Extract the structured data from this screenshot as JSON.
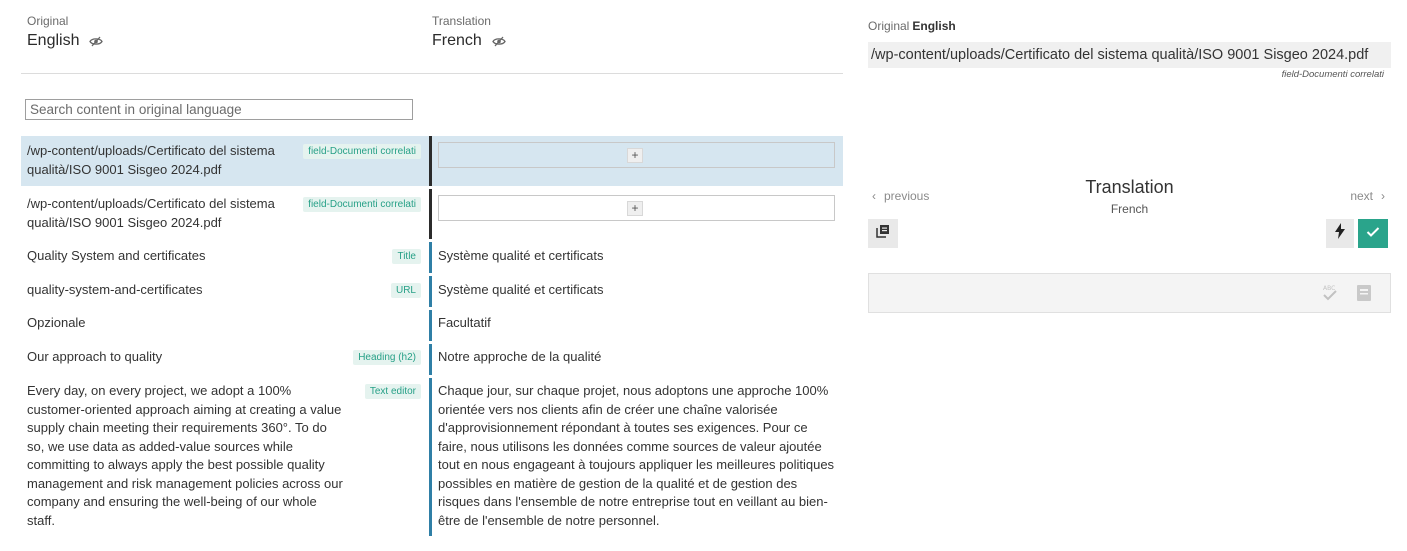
{
  "left": {
    "original": {
      "caption": "Original",
      "language": "English"
    },
    "translation": {
      "caption": "Translation",
      "language": "French"
    },
    "search_placeholder": "Search content in original language",
    "rows": [
      {
        "original": "/wp-content/uploads/Certificato del sistema qualità/ISO 9001 Sisgeo 2024.pdf",
        "tag": "field-Documenti correlati",
        "translation": ""
      },
      {
        "original": "/wp-content/uploads/Certificato del sistema qualità/ISO 9001 Sisgeo 2024.pdf",
        "tag": "field-Documenti correlati",
        "translation": ""
      },
      {
        "original": "Quality System and certificates",
        "tag": "Title",
        "translation": "Système qualité et certificats"
      },
      {
        "original": "quality-system-and-certificates",
        "tag": "URL",
        "translation": "Système qualité et certificats"
      },
      {
        "original": "Opzionale",
        "tag": "",
        "translation": "Facultatif"
      },
      {
        "original": "Our approach to quality",
        "tag": "Heading (h2)",
        "translation": "Notre approche de la qualité"
      },
      {
        "original": "Every day, on every project, we adopt a 100% customer-oriented approach aiming at creating a value supply chain meeting their requirements 360°. To do so, we use data as added-value sources while committing to always apply the best possible quality management and risk management policies across our company and ensuring the well-being of our whole staff.",
        "tag": "Text editor",
        "translation": "Chaque jour, sur chaque projet, nous adoptons une approche 100% orientée vers nos clients afin de créer une chaîne valorisée d'approvisionnement répondant à toutes ses exigences. Pour ce faire, nous utilisons les données comme sources de valeur ajoutée tout en nous engageant à toujours appliquer les meilleures politiques possibles en matière de gestion de la qualité et de gestion des risques dans l'ensemble de notre entreprise tout en veillant au bien-être de l'ensemble de notre personnel."
      }
    ],
    "plus_label": "+"
  },
  "right": {
    "original_caption": "Original",
    "original_language": "English",
    "source_text": "/wp-content/uploads/Certificato del sistema qualità/ISO 9001 Sisgeo 2024.pdf",
    "field_name": "field-Documenti correlati",
    "previous_label": "previous",
    "next_label": "next",
    "title": "Translation",
    "target_language": "French",
    "icons": {
      "copy": "copy-original-icon",
      "bolt": "machine-translate-icon",
      "ok": "checkmark-icon",
      "spell": "spellcheck-icon",
      "glossary": "glossary-book-icon"
    }
  },
  "colors": {
    "accent": "#2aa48b",
    "active_row": "#d6e6f0",
    "tag_bg": "#e5f3ef",
    "tag_text": "#27a087",
    "divider_done": "#2f7fa6",
    "divider_todo": "#2b2b2b"
  }
}
